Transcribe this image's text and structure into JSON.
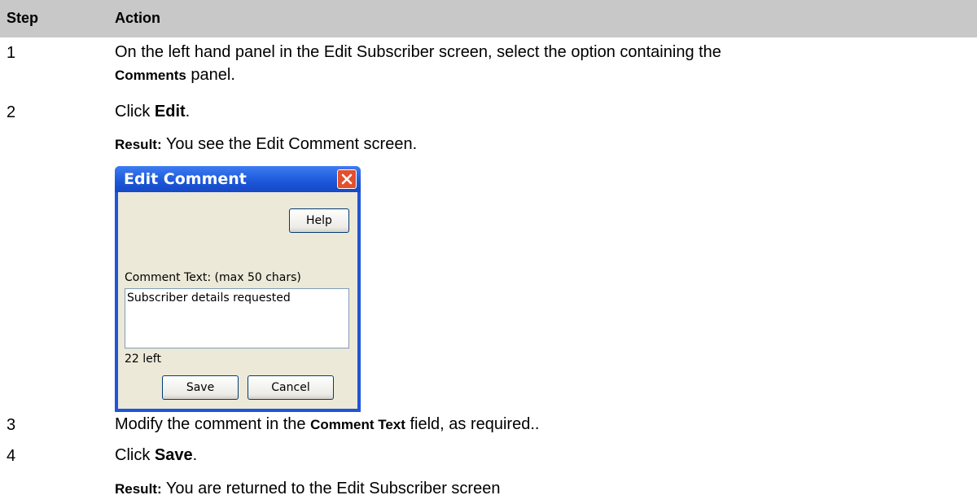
{
  "table": {
    "header": {
      "step": "Step",
      "action": "Action"
    },
    "rows": [
      {
        "step": "1",
        "text_a": "On the left hand panel in the Edit Subscriber screen, select the option containing the",
        "bold": "Comments",
        "text_b": " panel."
      },
      {
        "step": "2",
        "text_a": "Click ",
        "bold": "Edit",
        "text_b": "."
      },
      {
        "step": "3",
        "text_a": "Modify the comment in the ",
        "bold": "Comment Text",
        "text_b": " field, as required.."
      },
      {
        "step": "4",
        "text_a": "Click ",
        "bold": "Save",
        "text_b": "."
      }
    ],
    "results": [
      {
        "label": "Result:",
        "text": " You see the Edit Comment screen."
      },
      {
        "label": "Result:",
        "text": " You are returned to the Edit Subscriber screen"
      }
    ]
  },
  "dialog": {
    "title": "Edit Comment",
    "help_label": "Help",
    "comment_label": "Comment Text:  (max 50 chars)",
    "comment_value": "Subscriber details requested",
    "remaining": "22 left",
    "save_label": "Save",
    "cancel_label": "Cancel"
  },
  "colors": {
    "header_bg": "#c8c8c8",
    "titlebar": "#1f55d6",
    "close": "#e2502e",
    "dialog_bg": "#ece9d8"
  }
}
